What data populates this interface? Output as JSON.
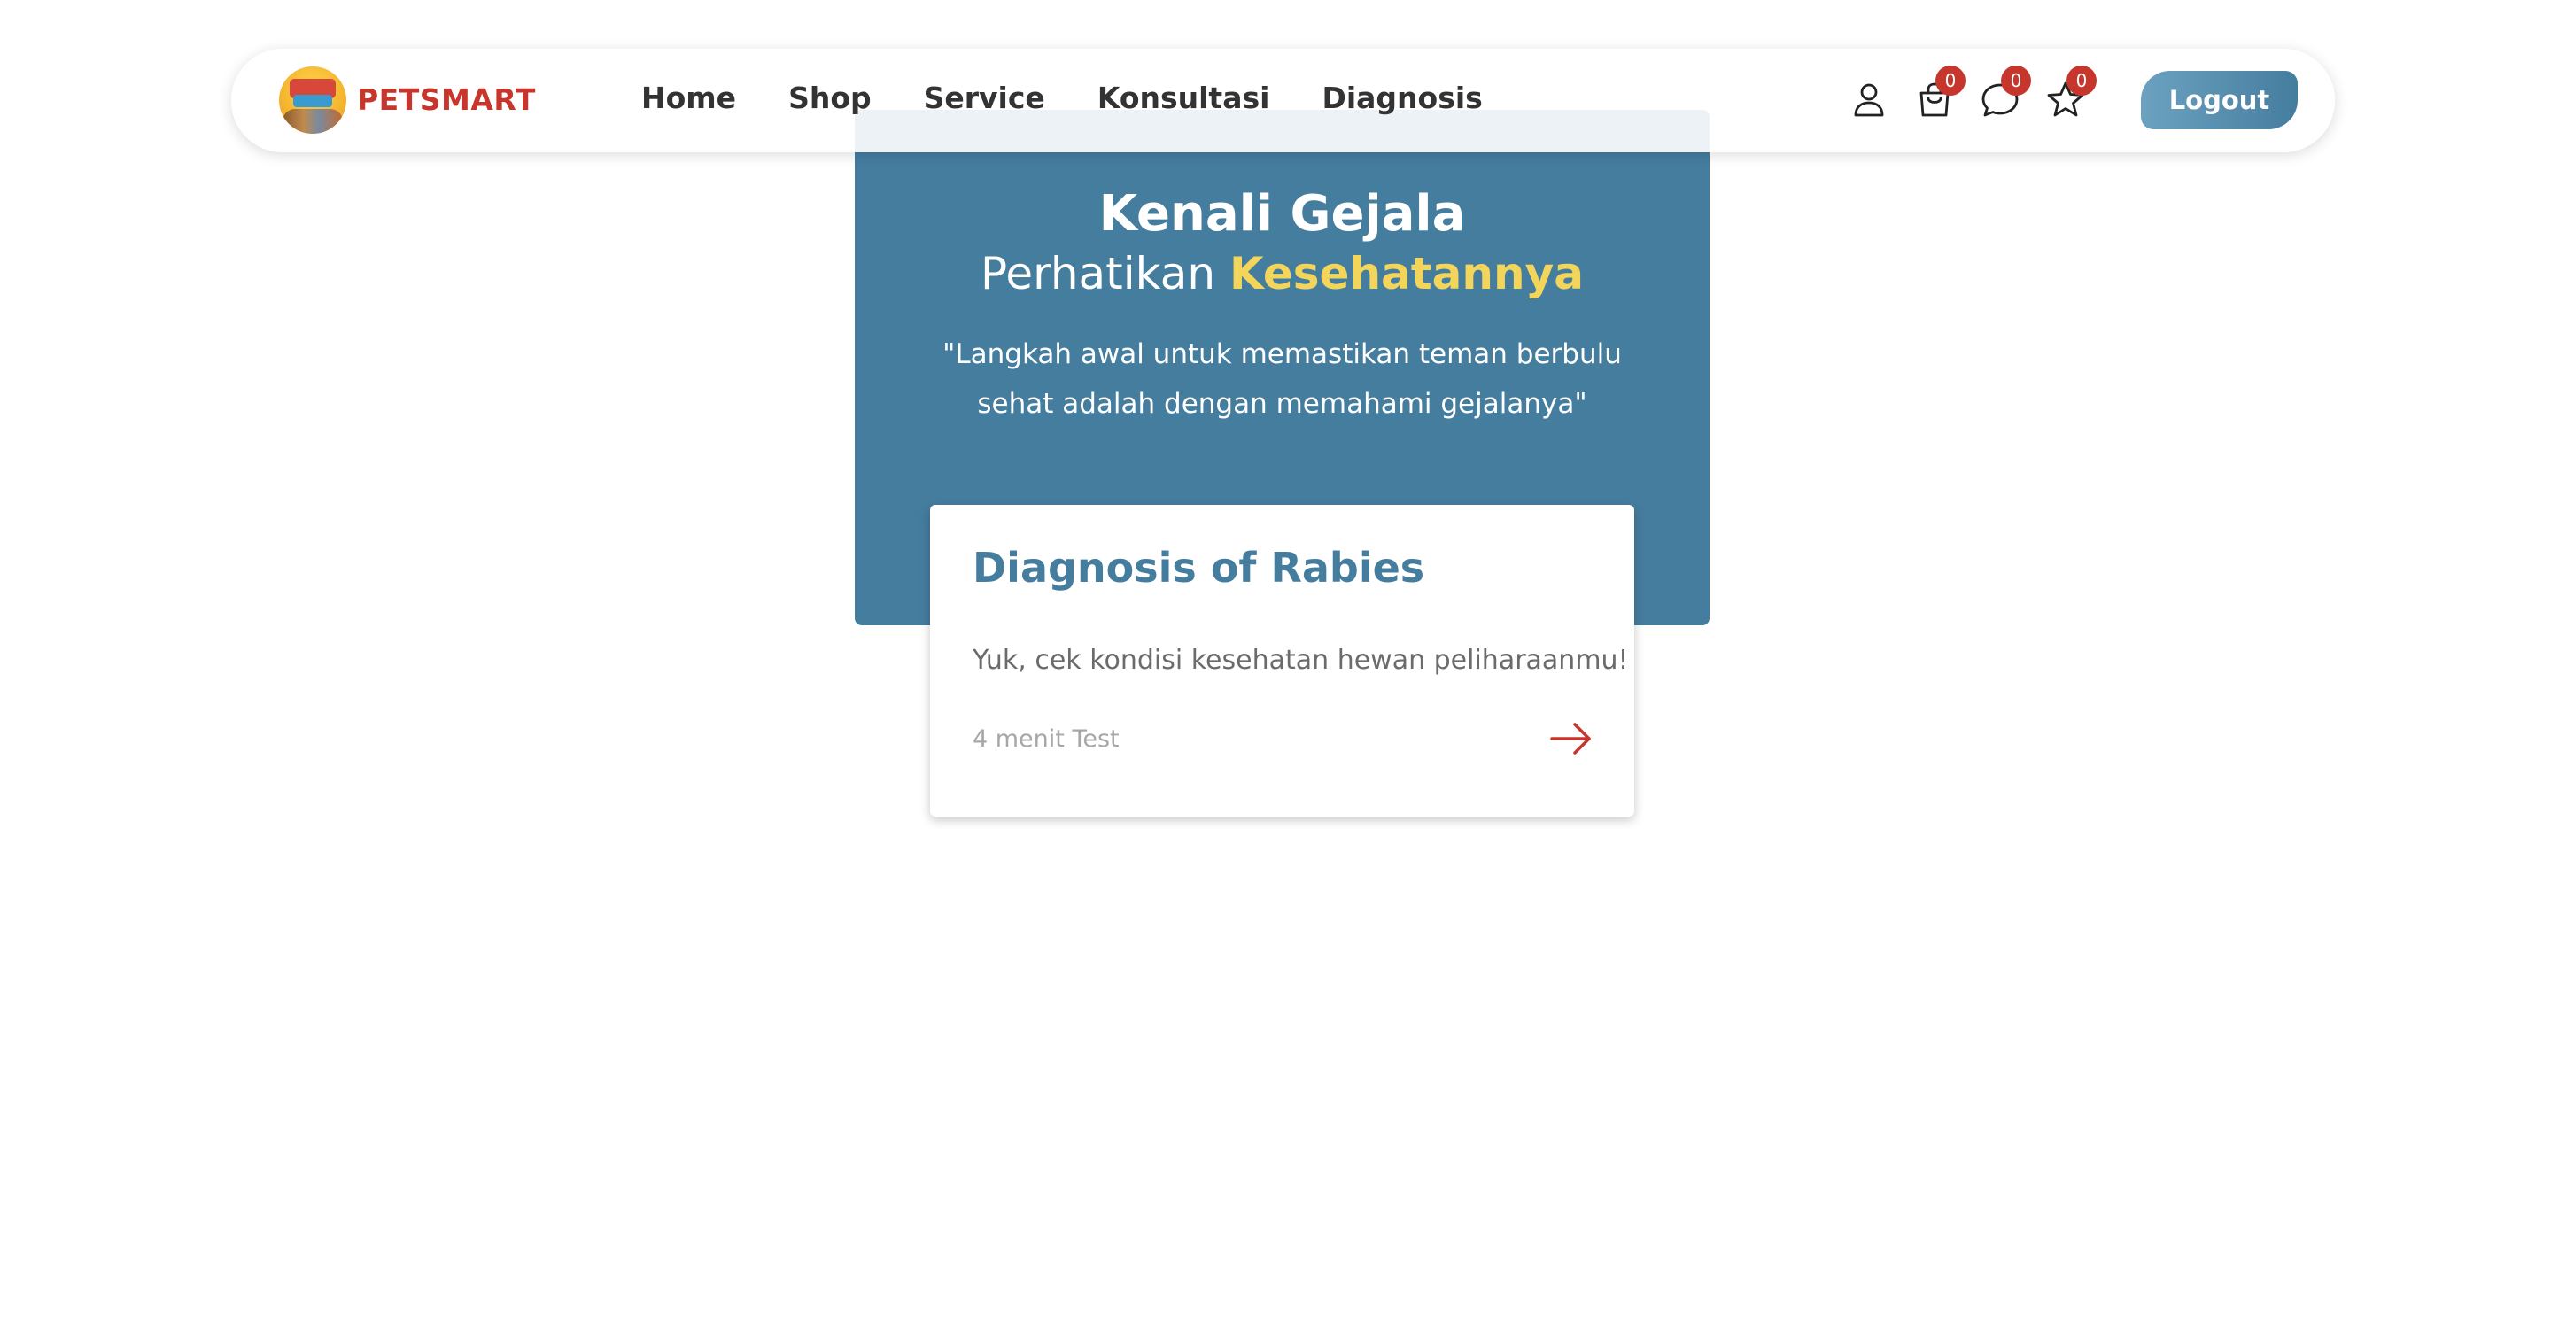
{
  "navbar": {
    "brand": "PETSMART",
    "links": [
      "Home",
      "Shop",
      "Service",
      "Konsultasi",
      "Diagnosis"
    ],
    "icons": [
      {
        "name": "user-icon",
        "badge": null
      },
      {
        "name": "shopping-bag-icon",
        "badge": "0"
      },
      {
        "name": "chat-icon",
        "badge": "0"
      },
      {
        "name": "star-icon",
        "badge": "0"
      }
    ],
    "logout_label": "Logout"
  },
  "hero": {
    "title": "Kenali Gejala",
    "subtitle_prefix": "Perhatikan",
    "subtitle_accent": "Kesehatannya",
    "quote": "\"Langkah awal untuk memastikan teman berbulu sehat adalah dengan memahami gejalanya\""
  },
  "card": {
    "title": "Diagnosis of Rabies",
    "description": "Yuk, cek kondisi kesehatan hewan peliharaanmu!",
    "meta": "4 menit Test"
  },
  "colors": {
    "primary": "#457d9f",
    "brand_red": "#c6362c",
    "accent_yellow": "#f2d55a"
  }
}
